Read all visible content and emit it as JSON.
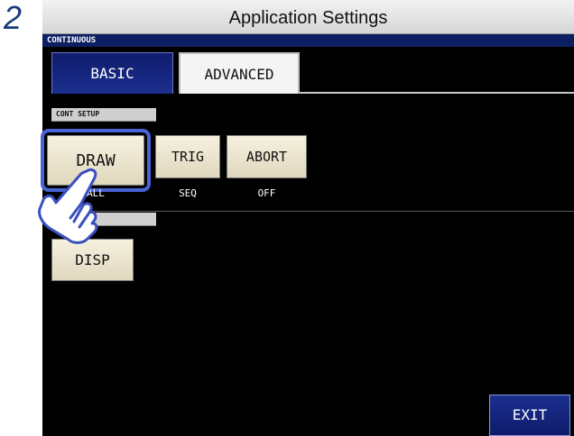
{
  "step_number": "2",
  "window": {
    "title": "Application Settings"
  },
  "mode": {
    "label": "CONTINUOUS"
  },
  "tabs": [
    {
      "label": "BASIC",
      "active": true
    },
    {
      "label": "ADVANCED",
      "active": false
    }
  ],
  "sections": {
    "cont_setup": {
      "label": "CONT SETUP",
      "buttons": [
        {
          "label": "DRAW",
          "value": "ALL"
        },
        {
          "label": "TRIG",
          "value": "SEQ"
        },
        {
          "label": "ABORT",
          "value": "OFF"
        }
      ]
    },
    "function": {
      "label": "FUNCTION",
      "buttons": [
        {
          "label": "DISP"
        }
      ]
    }
  },
  "footer": {
    "exit_label": "EXIT"
  },
  "colors": {
    "screen_bg": "#000000",
    "mode_strip": "#0d1f63",
    "active_tab": "#1b2f8f",
    "button_face": "#ece5cc",
    "highlight": "#4a63d6"
  },
  "icons": {
    "pointer": "hand-pointer-icon"
  }
}
